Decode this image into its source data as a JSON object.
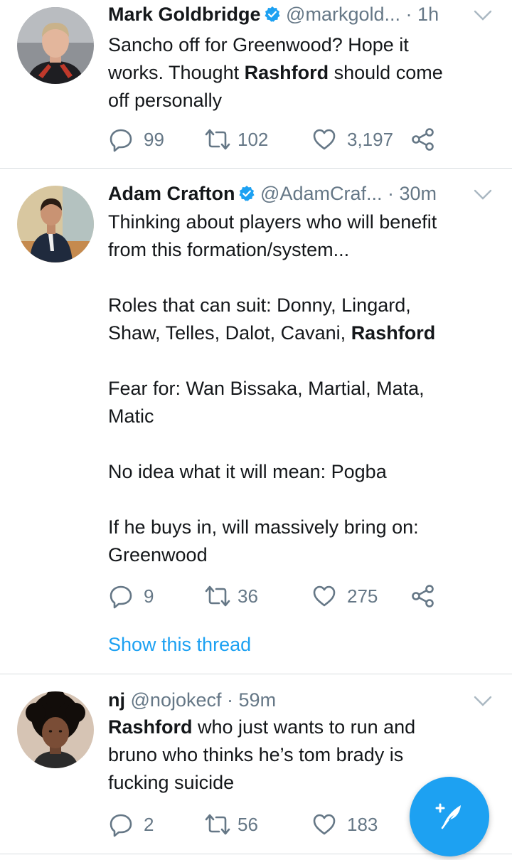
{
  "tweets": [
    {
      "name": "Mark Goldbridge",
      "handle": "@markgold...",
      "separator": "·",
      "time": "1h",
      "lines": [
        [
          {
            "t": "Sancho off for Greenwood? Hope it"
          }
        ],
        [
          {
            "t": "works. Thought "
          },
          {
            "t": "Rashford",
            "b": true
          },
          {
            "t": " should come"
          }
        ],
        [
          {
            "t": "off personally"
          }
        ]
      ],
      "stats": {
        "replies": "99",
        "retweets": "102",
        "likes": "3,197"
      }
    },
    {
      "name": "Adam Crafton",
      "handle": "@AdamCraf...",
      "separator": "·",
      "time": "30m",
      "lines": [
        [
          {
            "t": "Thinking about players who will benefit"
          }
        ],
        [
          {
            "t": "from this formation/system..."
          }
        ],
        [],
        [
          {
            "t": "Roles that can suit: Donny, Lingard,"
          }
        ],
        [
          {
            "t": "Shaw, Telles, Dalot, Cavani, "
          },
          {
            "t": "Rashford",
            "b": true
          }
        ],
        [],
        [
          {
            "t": "Fear for: Wan Bissaka, Martial, Mata,"
          }
        ],
        [
          {
            "t": "Matic"
          }
        ],
        [],
        [
          {
            "t": "No idea what it will mean: Pogba"
          }
        ],
        [],
        [
          {
            "t": "If he buys in, will massively bring on:"
          }
        ],
        [
          {
            "t": "Greenwood"
          }
        ]
      ],
      "stats": {
        "replies": "9",
        "retweets": "36",
        "likes": "275"
      },
      "thread_link": "Show this thread"
    },
    {
      "name": "nj",
      "handle": "@nojokecf",
      "separator": "·",
      "time": "59m",
      "lines": [
        [
          {
            "t": "Rashford",
            "b": true
          },
          {
            "t": " who just wants to run and"
          }
        ],
        [
          {
            "t": "bruno who thinks he’s tom brady is"
          }
        ],
        [
          {
            "t": "fucking suicide"
          }
        ]
      ],
      "stats": {
        "replies": "2",
        "retweets": "56",
        "likes": "183"
      }
    }
  ],
  "icons": {
    "verified": "verified-badge-icon",
    "reply": "reply-bubble-icon",
    "retweet": "retweet-icon",
    "like": "heart-icon",
    "share": "share-icon",
    "more": "chevron-down-icon",
    "compose": "compose-feather-icon"
  },
  "colors": {
    "accent": "#1da1f2",
    "text": "#14171a",
    "muted": "#657786",
    "divider": "#d9dde0"
  }
}
